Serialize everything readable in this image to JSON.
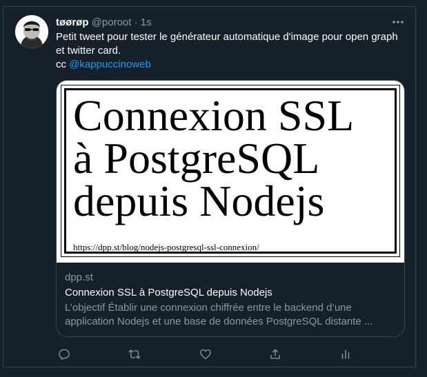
{
  "tweet": {
    "display_name": "tøørøp",
    "handle": "@poroot",
    "separator": "·",
    "time": "1s",
    "text_line1": "Petit tweet pour tester le générateur automatique d'image pour open graph et twitter card.",
    "text_line2_prefix": "cc ",
    "mention": "@kappuccinoweb"
  },
  "card": {
    "image_title_line1": "Connexion SSL",
    "image_title_line2": "à PostgreSQL",
    "image_title_line3": "depuis Nodejs",
    "image_url": "https://dpp.st/blog/nodejs-postgresql-ssl-connexion/",
    "domain": "dpp.st",
    "title": "Connexion SSL à PostgreSQL depuis Nodejs",
    "description": "L’objectif Établir une connexion chiffrée entre le backend d’une application Nodejs et une base de données PostgreSQL distante ..."
  },
  "icons": {
    "more": "more-horizontal-icon",
    "reply": "reply-icon",
    "retweet": "retweet-icon",
    "like": "heart-icon",
    "share": "share-icon",
    "analytics": "analytics-icon"
  },
  "colors": {
    "background": "#15202b",
    "border": "#38444d",
    "muted": "#8b98a5",
    "accent": "#1d9bf0"
  }
}
